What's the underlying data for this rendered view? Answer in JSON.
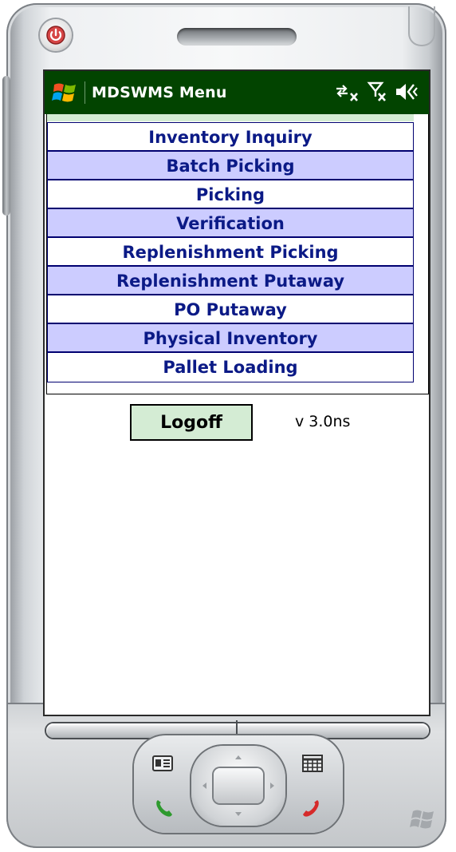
{
  "window": {
    "title": "MDSWMS Menu"
  },
  "status_icons": [
    "connectivity-icon",
    "signal-off-icon",
    "volume-icon"
  ],
  "menu": {
    "items": [
      {
        "label": "Inventory Inquiry"
      },
      {
        "label": "Batch Picking"
      },
      {
        "label": "Picking"
      },
      {
        "label": "Verification"
      },
      {
        "label": "Replenishment Picking"
      },
      {
        "label": "Replenishment Putaway"
      },
      {
        "label": "PO Putaway"
      },
      {
        "label": "Physical Inventory"
      },
      {
        "label": "Pallet Loading"
      }
    ]
  },
  "footer": {
    "logoff_label": "Logoff",
    "version": "v 3.0ns"
  },
  "colors": {
    "titlebar": "#024400",
    "menu_text": "#0b1a86",
    "menu_alt_row": "#ccccff",
    "logoff_bg": "#d4ecd4"
  }
}
